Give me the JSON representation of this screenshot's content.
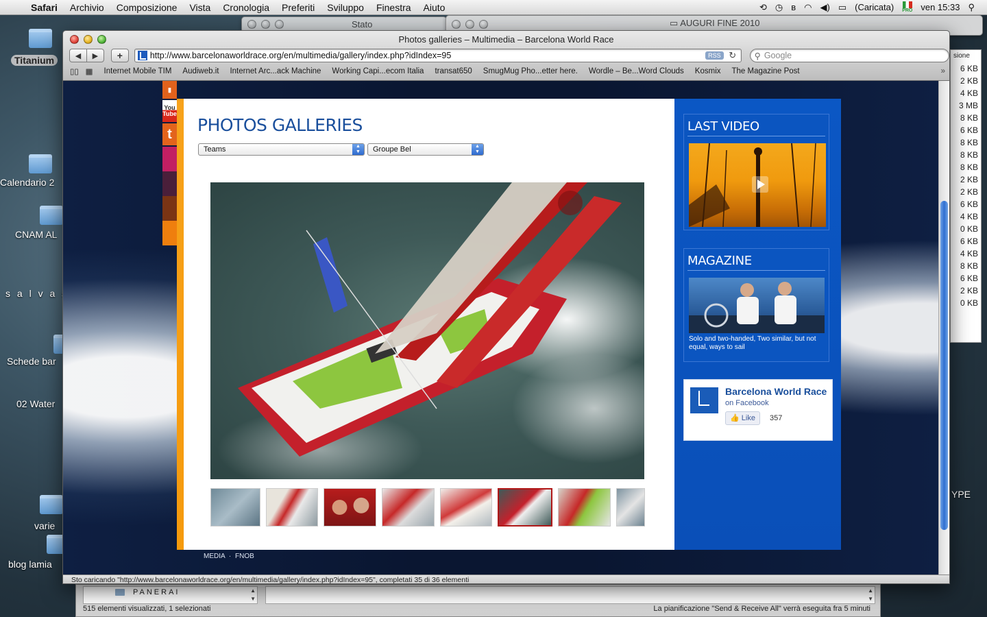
{
  "menubar": {
    "app": "Safari",
    "items": [
      "Archivio",
      "Composizione",
      "Vista",
      "Cronologia",
      "Preferiti",
      "Sviluppo",
      "Finestra",
      "Aiuto"
    ],
    "battery": "(Caricata)",
    "flag_label": "PRO",
    "clock": "ven 15:33"
  },
  "desktop": {
    "icons": [
      "Titanium",
      "Calendario 2",
      "CNAM AL",
      "s a l v a s c",
      "Schede bar",
      "02 Water",
      "varie",
      "blog lamia",
      "PANERAI"
    ],
    "bg_window_title": "Stato",
    "folder_title": "AUGURI FINE 2010",
    "right_list_header": "sione",
    "right_list": [
      "6 KB",
      "2 KB",
      "4 KB",
      "3 MB",
      "8 KB",
      "6 KB",
      "8 KB",
      "8 KB",
      "8 KB",
      "2 KB",
      "2 KB",
      "6 KB",
      "4 KB",
      "0 KB",
      "6 KB",
      "4 KB",
      "8 KB",
      "6 KB",
      "2 KB",
      "0 KB"
    ],
    "right_partial": "YPE",
    "finder_status": "515 elementi visualizzati, 1 selezionati",
    "finder_schedule": "La pianificazione \"Send & Receive All\" verrà eseguita fra 5 minuti"
  },
  "browser": {
    "title": "Photos galleries – Multimedia – Barcelona World Race",
    "url": "http://www.barcelonaworldrace.org/en/multimedia/gallery/index.php?idIndex=95",
    "rss": "RSS",
    "search_placeholder": "Google",
    "bookmarks": [
      "Internet Mobile TIM",
      "Audiweb.it",
      "Internet Arc...ack Machine",
      "Working Capi...ecom Italia",
      "transat650",
      "SmugMug Pho...etter here.",
      "Wordle – Be...Word Clouds",
      "Kosmix",
      "The Magazine Post"
    ],
    "status": "Sto caricando \"http://www.barcelonaworldrace.org/en/multimedia/gallery/index.php?idIndex=95\", completati 35 di 36 elementi"
  },
  "page": {
    "title": "PHOTOS GALLERIES",
    "select_category": "Teams",
    "select_team": "Groupe Bel",
    "footer": "MEDIA · FNOB",
    "social": {
      "youtube_top": "You",
      "youtube_bottom": "Tube"
    },
    "thumbnail_count": 8,
    "active_thumbnail": 6,
    "sidebar": {
      "last_video": "LAST VIDEO",
      "magazine": "MAGAZINE",
      "magazine_caption": "Solo and two-handed, Two similar, but not equal, ways to sail",
      "fb_name": "Barcelona World Race",
      "fb_on": "on Facebook",
      "fb_like": "Like",
      "fb_count": "357"
    }
  },
  "colors": {
    "brand_blue": "#0b55c0",
    "title_blue": "#1a4f9c",
    "accent_orange": "#f7a21b",
    "active_thumb": "#b01818"
  }
}
